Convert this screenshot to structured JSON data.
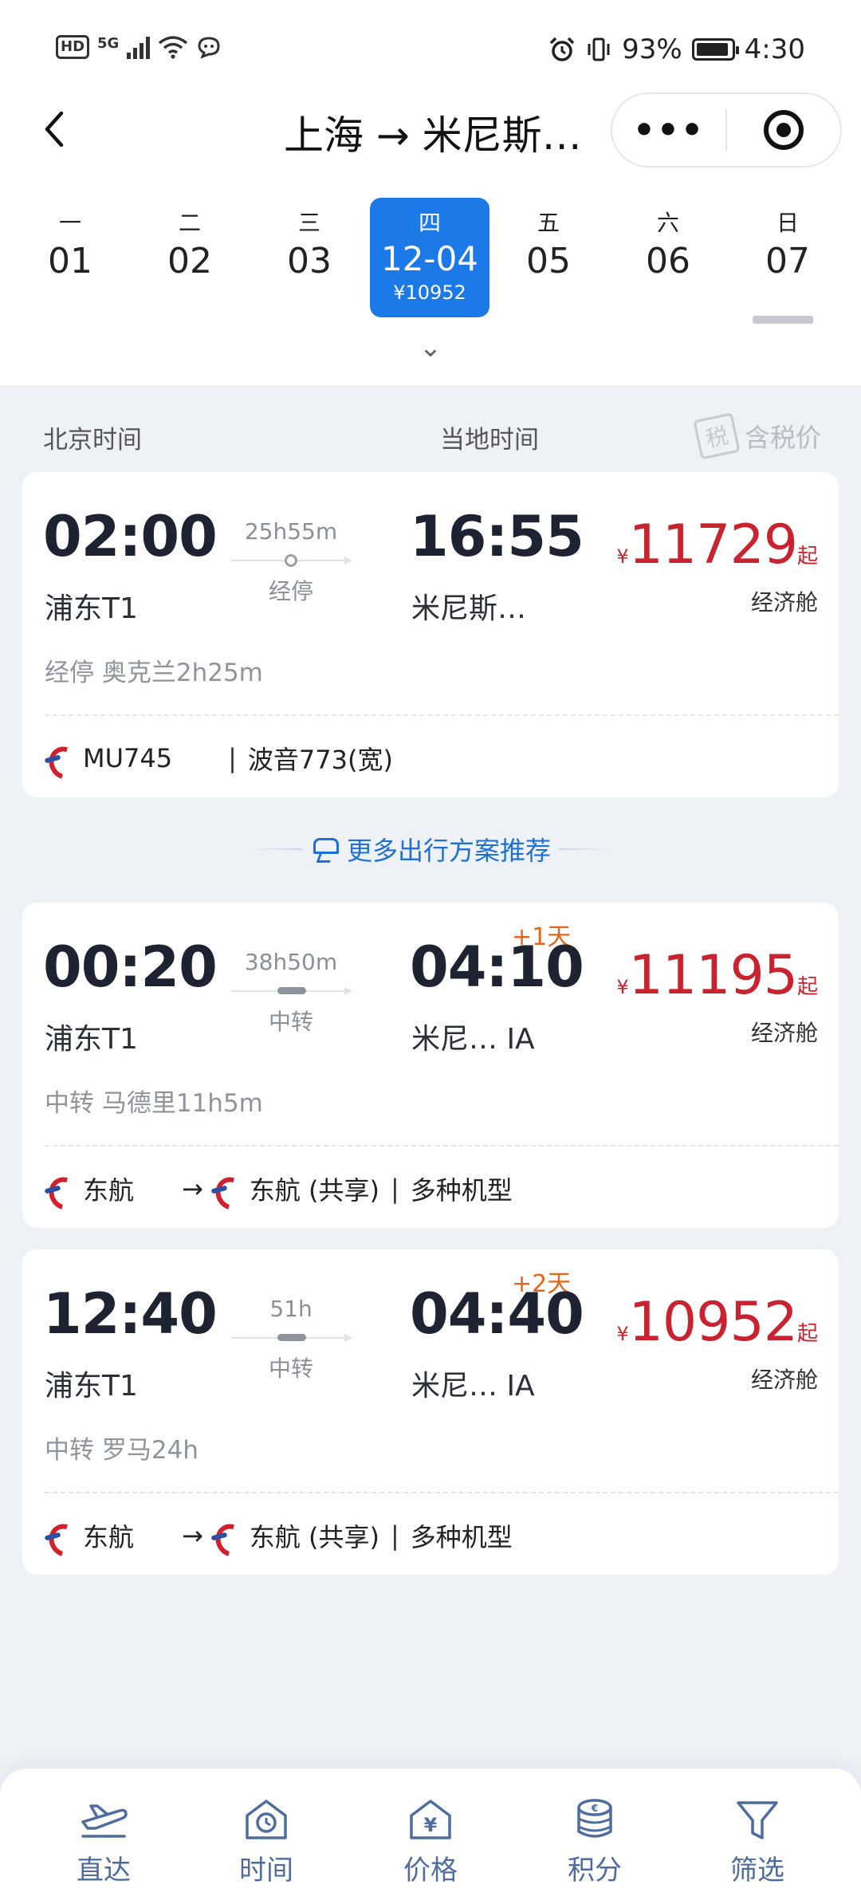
{
  "status_bar": {
    "network_left": "HD",
    "network_type": "5G",
    "battery_percent": "93%",
    "battery_level": 0.93,
    "time": "4:30"
  },
  "header": {
    "title": "上海 → 米尼斯…",
    "more_label": "•••"
  },
  "date_strip": {
    "days": [
      {
        "weekday": "一",
        "date": "01"
      },
      {
        "weekday": "二",
        "date": "02"
      },
      {
        "weekday": "三",
        "date": "03"
      },
      {
        "weekday": "四",
        "date": "12-04",
        "price": "¥10952"
      },
      {
        "weekday": "五",
        "date": "05"
      },
      {
        "weekday": "六",
        "date": "06"
      },
      {
        "weekday": "日",
        "date": "07"
      }
    ],
    "selected_index": 3,
    "expand_glyph": "⌄"
  },
  "column_header": {
    "beijing_time": "北京时间",
    "local_time": "当地时间",
    "tax_label": "含税价",
    "tax_icon_glyph": "税"
  },
  "flights": [
    {
      "dep_time": "02:00",
      "dep_airport": "浦东T1",
      "duration": "25h55m",
      "stop_type": "经停",
      "arr_time": "16:55",
      "arr_airport": "米尼斯…",
      "plus_day": "",
      "currency": "¥",
      "price": "11729",
      "price_suffix": "起",
      "cabin": "经济舱",
      "stop_info": "经停 奥克兰2h25m",
      "airline_main": "MU745",
      "airline_second": "",
      "aircraft": "波音773(宽)"
    },
    {
      "dep_time": "00:20",
      "dep_airport": "浦东T1",
      "duration": "38h50m",
      "stop_type": "中转",
      "arr_time": "04:10",
      "arr_airport": "米尼…  IA",
      "plus_day": "+1天",
      "currency": "¥",
      "price": "11195",
      "price_suffix": "起",
      "cabin": "经济舱",
      "stop_info": "中转 马德里11h5m",
      "airline_main": "东航",
      "airline_second": "东航 (共享)",
      "aircraft": "多种机型"
    },
    {
      "dep_time": "12:40",
      "dep_airport": "浦东T1",
      "duration": "51h",
      "stop_type": "中转",
      "arr_time": "04:40",
      "arr_airport": "米尼…  IA",
      "plus_day": "+2天",
      "currency": "¥",
      "price": "10952",
      "price_suffix": "起",
      "cabin": "经济舱",
      "stop_info": "中转 罗马24h",
      "airline_main": "东航",
      "airline_second": "东航 (共享)",
      "aircraft": "多种机型"
    }
  ],
  "recommendation": {
    "label": "更多出行方案推荐"
  },
  "bottom_nav": [
    {
      "label": "直达",
      "icon": "plane-icon"
    },
    {
      "label": "时间",
      "icon": "clock-icon"
    },
    {
      "label": "价格",
      "icon": "price-tag-icon"
    },
    {
      "label": "积分",
      "icon": "coins-icon"
    },
    {
      "label": "筛选",
      "icon": "filter-icon"
    }
  ],
  "colors": {
    "accent": "#1c79e8",
    "price_red": "#c8232e",
    "plus_day_orange": "#e2661b",
    "nav_blue": "#4e6d9e"
  },
  "arrow_glyph": "→",
  "pipe_glyph": "|"
}
